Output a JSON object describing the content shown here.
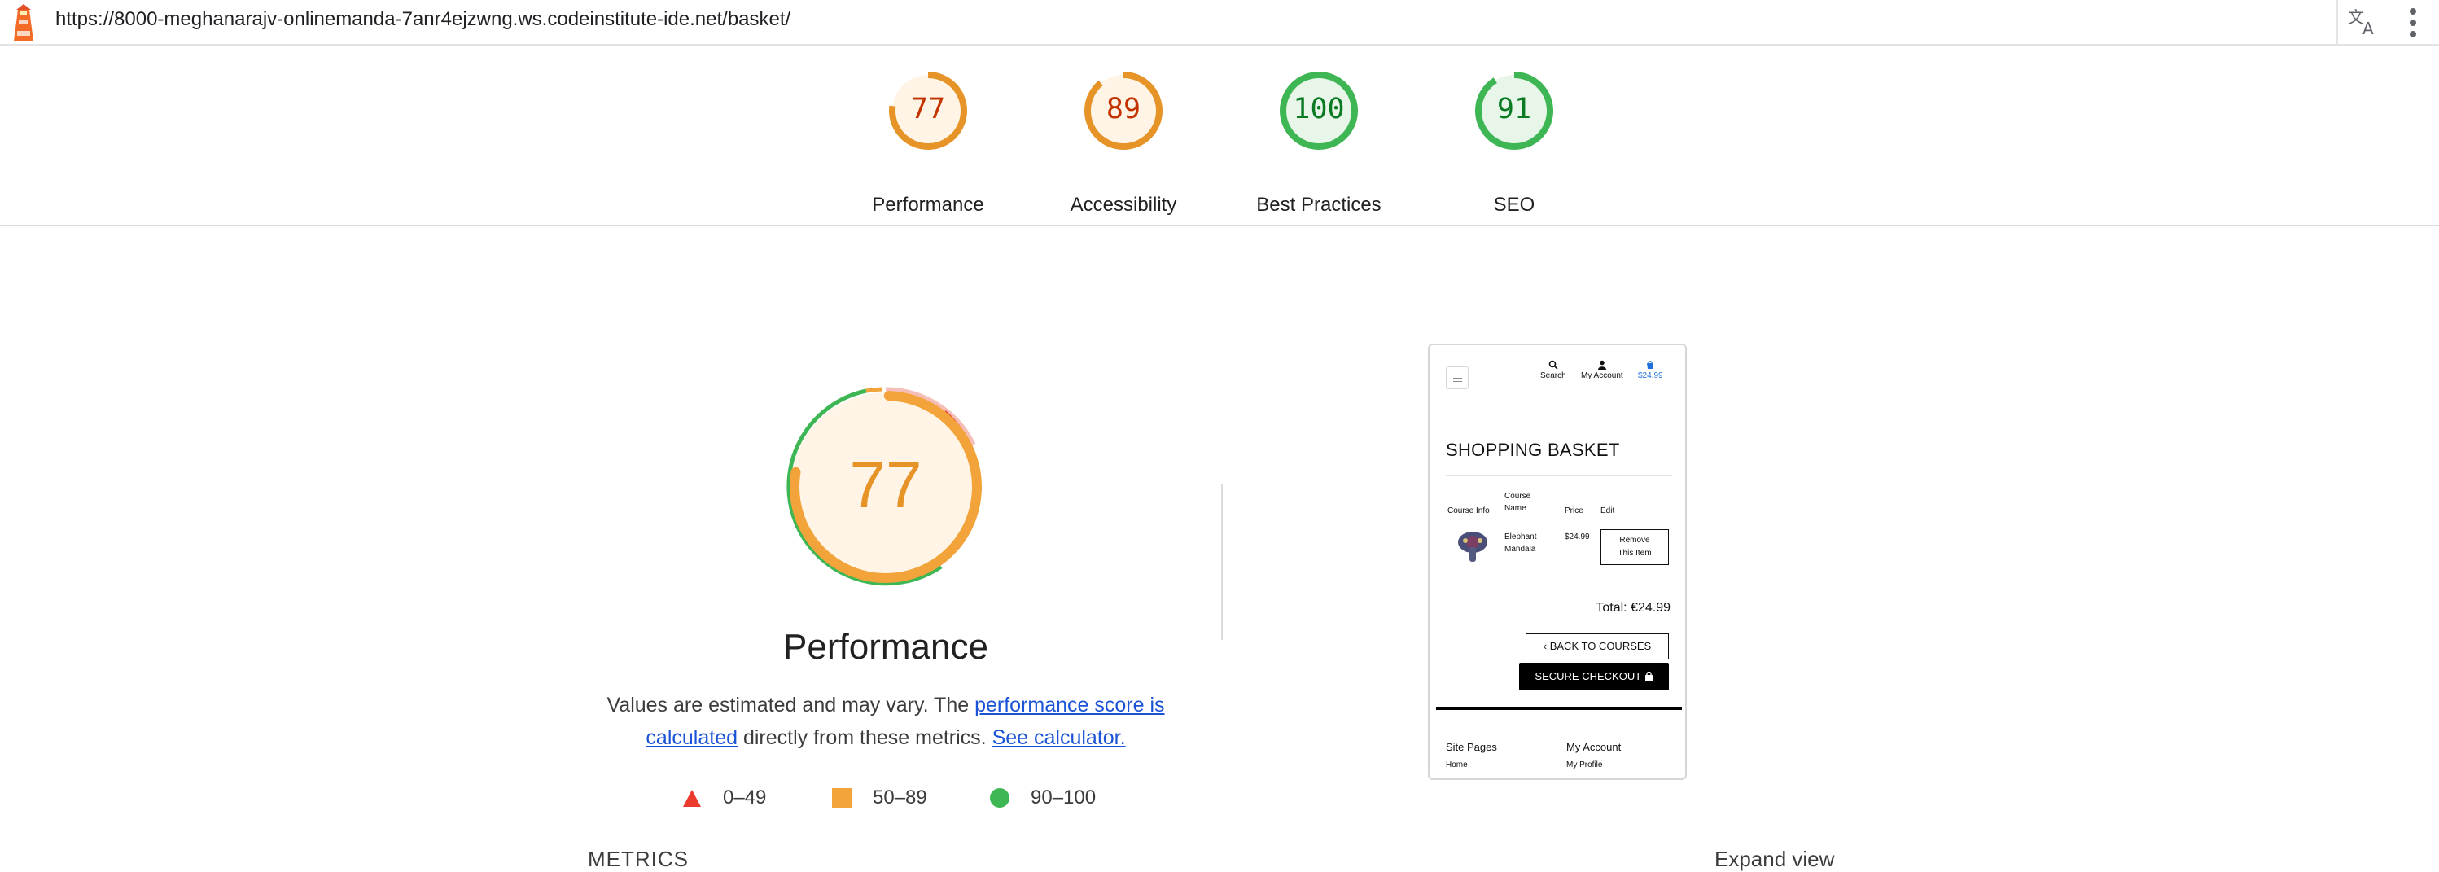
{
  "browser": {
    "url": "https://8000-meghanarajv-onlinemanda-7anr4ejzwng.ws.codeinstitute-ide.net/basket/"
  },
  "scores": [
    {
      "label": "Performance",
      "value": "77",
      "score": 0.77,
      "color": "#e69428",
      "text_color": "#c33300",
      "bg": "#fff4e5"
    },
    {
      "label": "Accessibility",
      "value": "89",
      "score": 0.89,
      "color": "#e69428",
      "text_color": "#c33300",
      "bg": "#fff4e5"
    },
    {
      "label": "Best Practices",
      "value": "100",
      "score": 1.0,
      "color": "#3fb654",
      "text_color": "#0a7b23",
      "bg": "#e8f6ea"
    },
    {
      "label": "SEO",
      "value": "91",
      "score": 0.91,
      "color": "#3fb654",
      "text_color": "#0a7b23",
      "bg": "#e8f6ea"
    }
  ],
  "performance": {
    "score": "77",
    "title": "Performance",
    "desc_pre": "Values are estimated and may vary. The ",
    "desc_link1": "performance score is calculated",
    "desc_mid": " directly from these metrics. ",
    "desc_link2": "See calculator."
  },
  "legend": [
    {
      "label": "0–49",
      "color": "#eb3b2f",
      "shape": "triangle"
    },
    {
      "label": "50–89",
      "color": "#f2a33a",
      "shape": "square"
    },
    {
      "label": "90–100",
      "color": "#3fb654",
      "shape": "circle"
    }
  ],
  "metrics_label": "METRICS",
  "expand_label": "Expand view",
  "thumbnail": {
    "nav": {
      "search": "Search",
      "account": "My Account",
      "basket": "$24.99"
    },
    "title": "SHOPPING BASKET",
    "headers": {
      "info": "Course Info",
      "name_1": "Course",
      "name_2": "Name",
      "price": "Price",
      "edit": "Edit"
    },
    "item": {
      "name_1": "Elephant",
      "name_2": "Mandala",
      "price": "$24.99",
      "remove_1": "Remove",
      "remove_2": "This Item"
    },
    "total": "Total: €24.99",
    "back": "BACK TO COURSES",
    "checkout": "SECURE CHECKOUT",
    "footer": {
      "col1": "Site Pages",
      "col1_sub": "Home",
      "col2": "My Account",
      "col2_sub": "My Profile"
    }
  }
}
